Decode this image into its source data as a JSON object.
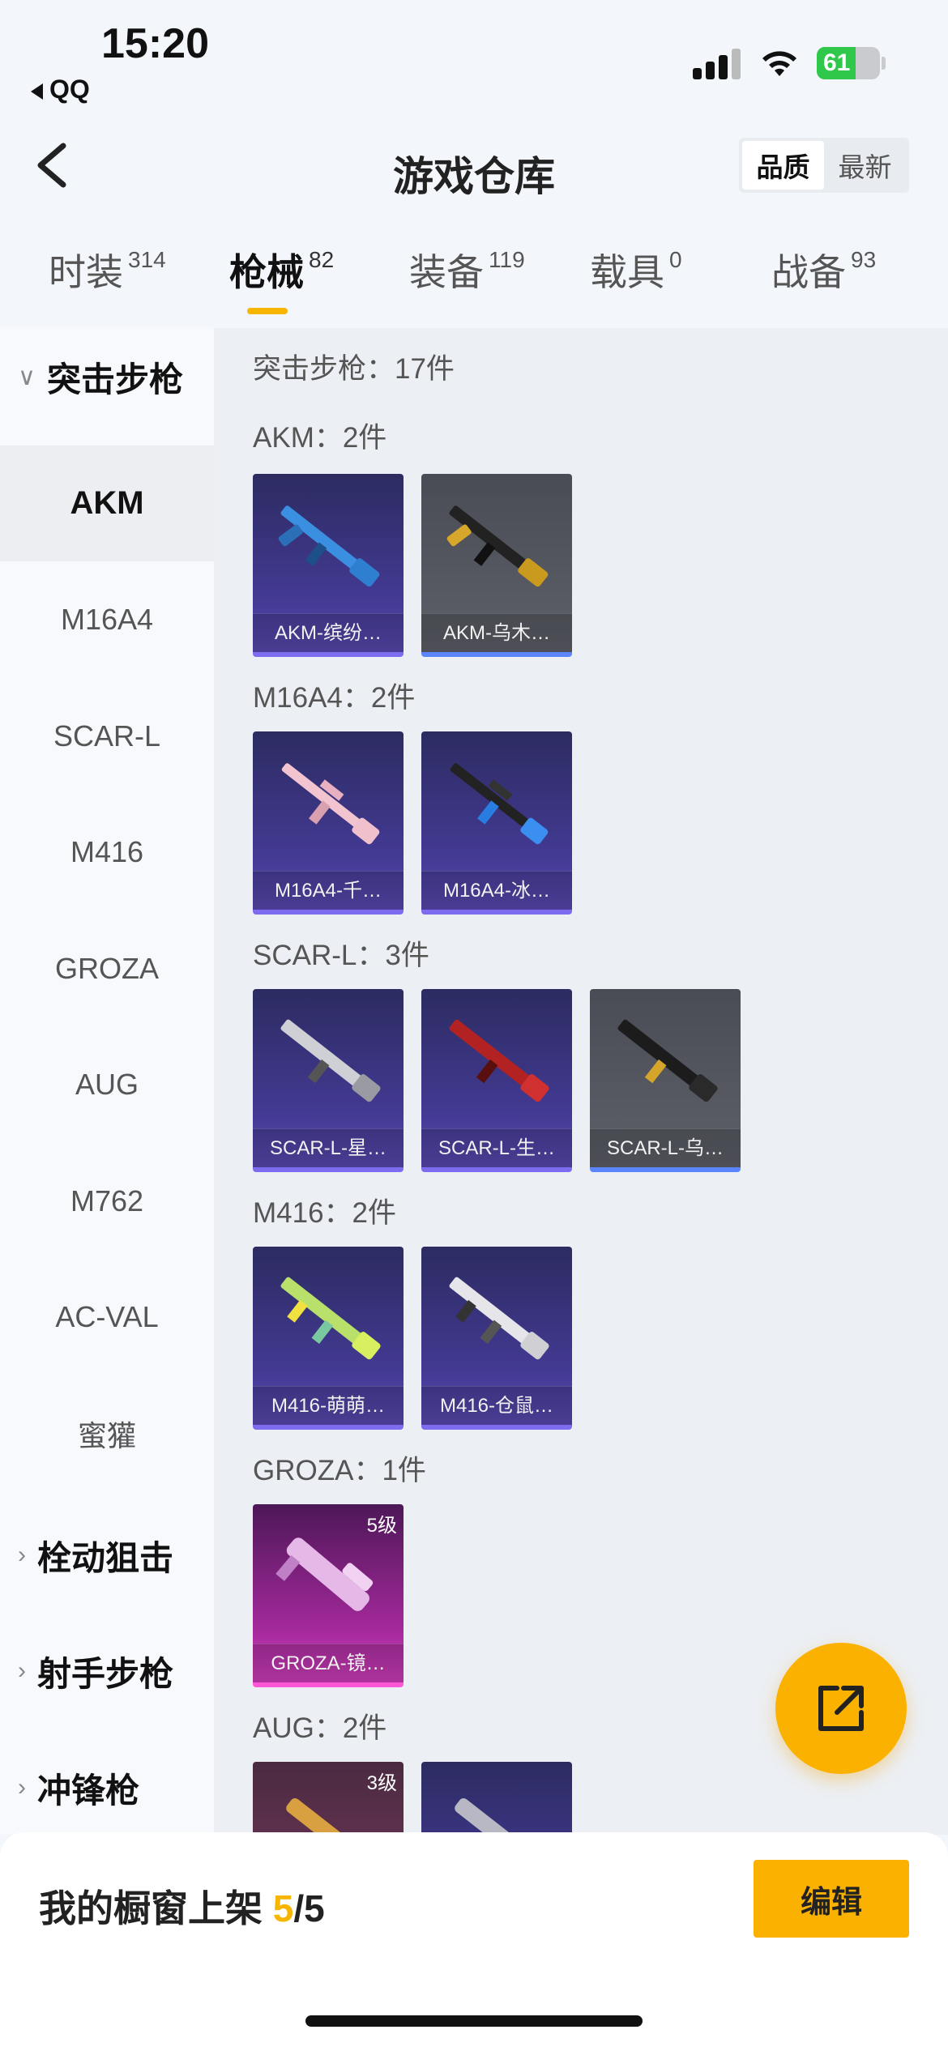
{
  "status_bar": {
    "time": "15:20",
    "back_app": "QQ",
    "battery": "61"
  },
  "header": {
    "title": "游戏仓库",
    "sort": [
      "品质",
      "最新"
    ]
  },
  "tabs": [
    {
      "label": "时装",
      "count": "314"
    },
    {
      "label": "枪械",
      "count": "82"
    },
    {
      "label": "装备",
      "count": "119"
    },
    {
      "label": "载具",
      "count": "0"
    },
    {
      "label": "战备",
      "count": "93"
    }
  ],
  "sidebar": {
    "groups": [
      "突击步枪",
      "栓动狙击",
      "射手步枪",
      "冲锋枪"
    ],
    "items": [
      "AKM",
      "M16A4",
      "SCAR-L",
      "M416",
      "GROZA",
      "AUG",
      "M762",
      "AC-VAL",
      "蜜獾"
    ]
  },
  "content": {
    "category_title": "突击步枪：17件",
    "sections": [
      {
        "title": "AKM：2件",
        "cards": [
          {
            "label": "AKM-缤纷…"
          },
          {
            "label": "AKM-乌木…"
          }
        ]
      },
      {
        "title": "M16A4：2件",
        "cards": [
          {
            "label": "M16A4-千…"
          },
          {
            "label": "M16A4-冰…"
          }
        ]
      },
      {
        "title": "SCAR-L：3件",
        "cards": [
          {
            "label": "SCAR-L-星…"
          },
          {
            "label": "SCAR-L-生…"
          },
          {
            "label": "SCAR-L-乌…"
          }
        ]
      },
      {
        "title": "M416：2件",
        "cards": [
          {
            "label": "M416-萌萌…"
          },
          {
            "label": "M416-仓鼠…"
          }
        ]
      },
      {
        "title": "GROZA：1件",
        "cards": [
          {
            "label": "GROZA-镜…",
            "level": "5级"
          }
        ]
      },
      {
        "title": "AUG：2件",
        "cards": [
          {
            "level": "3级"
          },
          {}
        ]
      }
    ]
  },
  "bottom": {
    "prefix": "我的橱窗上架 ",
    "count": "5",
    "total": "/5",
    "edit": "编辑"
  },
  "colors": {
    "accent": "#fbb100",
    "tab_underline": "#f6b500"
  }
}
